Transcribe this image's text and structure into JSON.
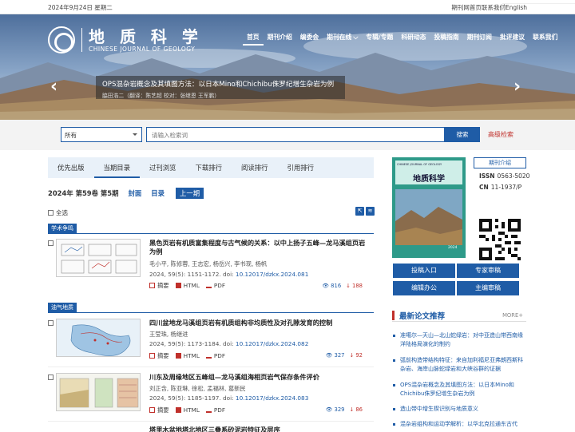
{
  "topbar": {
    "date": "2024年9月24日 星期二",
    "links": [
      "期刊网首页",
      "联系我们",
      "English"
    ]
  },
  "logo": {
    "cn": "地 质 科 学",
    "en": "CHINESE JOURNAL OF GEOLOGY"
  },
  "nav": {
    "items": [
      "首页",
      "期刊介绍",
      "编委会",
      "期刊在线",
      "专辑/专题",
      "科研动态",
      "投稿指南",
      "期刊订阅",
      "批评建议",
      "联系我们"
    ],
    "dropdown_marker": "⌵"
  },
  "hero": {
    "caption_title": "OPS混杂岩概念及其填图方法：以日本Mino和Chichibu侏罗纪增生杂岩为例",
    "caption_sub": "脇田浩二（翻译：陈艺超 校对：张继恩 王军鹏）",
    "prev_arrow": "‹",
    "next_arrow": "›"
  },
  "search": {
    "select_value": "所有",
    "placeholder": "请输入检索词",
    "button": "搜索",
    "advanced": "高级检索"
  },
  "tabs": [
    "优先出版",
    "当期目录",
    "过刊浏览",
    "下载排行",
    "阅读排行",
    "引用排行"
  ],
  "issue": {
    "label": "2024年 第59卷 第5期",
    "links": [
      "封面",
      "目录"
    ],
    "prev": "上一期"
  },
  "select_all": "全选",
  "sections": [
    {
      "label": "学术争鸣"
    },
    {
      "label": "油气地质"
    }
  ],
  "articles": [
    {
      "title": "黑色页岩有机质富集程度与古气候的关系：以中上扬子五峰—龙马溪组页岩为例",
      "authors": "毛小平, 陈修蓉, 王志宏, 杨岳兴, 李书现, 杨帆",
      "ref_prefix": "2024, 59(5): 1151-1172. doi: ",
      "doi": "10.12017/dzkx.2024.081",
      "abstract": "摘要",
      "html": "HTML",
      "pdf": "PDF",
      "views": "816",
      "downloads": "188"
    },
    {
      "title": "四川盆地龙马溪组页岩有机质组构非均质性及对孔隙发育的控制",
      "authors": "王莹珠, 杨继进",
      "ref_prefix": "2024, 59(5): 1173-1184. doi: ",
      "doi": "10.12017/dzkx.2024.082",
      "abstract": "摘要",
      "html": "HTML",
      "pdf": "PDF",
      "views": "327",
      "downloads": "92"
    },
    {
      "title": "川东及周缘地区五峰组—龙马溪组海相页岩气保存条件评价",
      "authors": "刘正含, 陈亚琳, 徐松, 孟福林, 葛新民",
      "ref_prefix": "2024, 59(5): 1185-1197. doi: ",
      "doi": "10.12017/dzkx.2024.083",
      "abstract": "摘要",
      "html": "HTML",
      "pdf": "PDF",
      "views": "329",
      "downloads": "86"
    },
    {
      "title": "塔里木盆地塔北地区三叠系砂泥岩特征及层序"
    }
  ],
  "sidebar": {
    "cover": {
      "top_text": "CHINESE JOURNAL OF GEOLOGY",
      "title": "地质科学",
      "year": "2024"
    },
    "intro_button": "期刊介绍",
    "issn": {
      "label": "ISSN",
      "value": "0563-5020"
    },
    "cn": {
      "label": "CN",
      "value": "11-1937/P"
    },
    "buttons": [
      "投稿入口",
      "专家审稿",
      "编辑办公",
      "主编审稿"
    ],
    "recommend_title": "最新论文推荐",
    "more": "MORE+",
    "recommend": [
      "准噶尔—天山—北山蛇绿岩：对中亚造山带西南缘洋陆格局演化的制约",
      "弧前构造带结构特征：来自加利福尼亚弗朗西斯科杂岩、海岸山脉蛇绿岩和大峡谷群的证据",
      "OPS混杂岩概念及其填图方法：以日本Mino和Chichibu侏罗纪增生杂岩为例",
      "造山带中增生楔识别与地质意义",
      "混杂岩组构和运动学解析：以华北克拉通东古代"
    ]
  },
  "colors": {
    "primary": "#1f5ca6",
    "accent": "#c0302b"
  }
}
